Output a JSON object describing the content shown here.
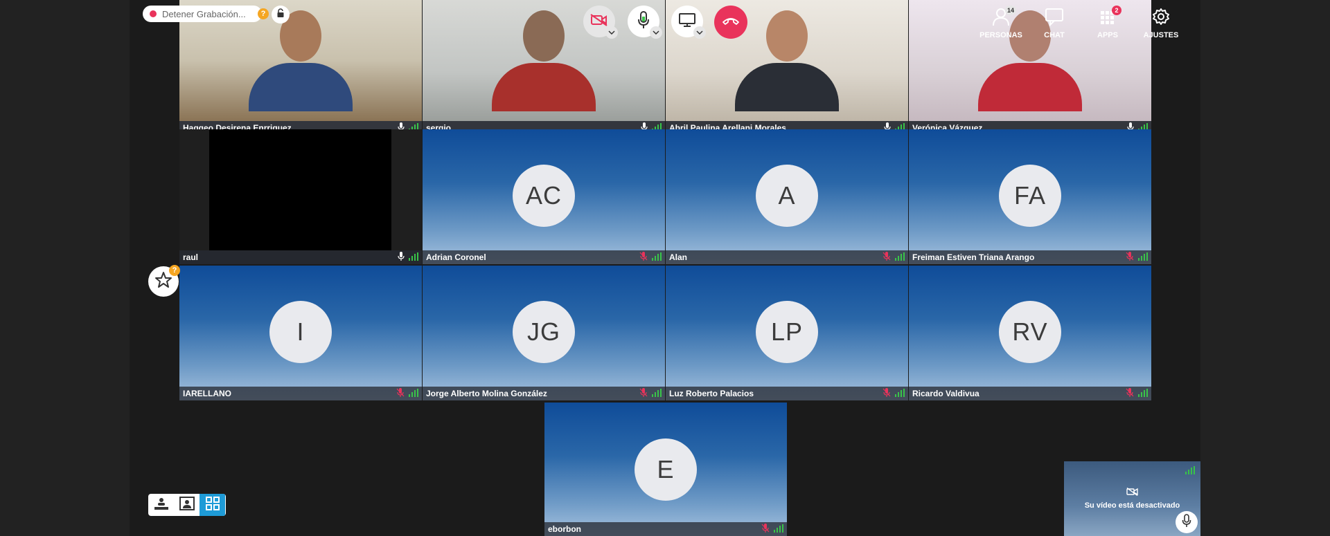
{
  "recording": {
    "label": "Detener Grabación...",
    "help_badge": "?"
  },
  "toolbar": {
    "personas": {
      "label": "PERSONAS",
      "count": "14"
    },
    "chat": {
      "label": "CHAT"
    },
    "apps": {
      "label": "APPS",
      "count": "2"
    },
    "ajustes": {
      "label": "AJUSTES"
    }
  },
  "favorites_badge": "?",
  "participants": [
    {
      "name": "Haggeo Desirena Enrriquez",
      "kind": "video",
      "muted": false
    },
    {
      "name": "sergio",
      "kind": "video",
      "muted": false
    },
    {
      "name": "Abril Paulina Arellani Morales",
      "kind": "video",
      "muted": false
    },
    {
      "name": "Verónica Vázquez",
      "kind": "video",
      "muted": false
    },
    {
      "name": "raul",
      "kind": "blank",
      "muted": false
    },
    {
      "name": "Adrian Coronel",
      "initials": "AC",
      "kind": "avatar",
      "muted": true
    },
    {
      "name": "Alan",
      "initials": "A",
      "kind": "avatar",
      "muted": true
    },
    {
      "name": "Freiman Estiven Triana Arango",
      "initials": "FA",
      "kind": "avatar",
      "muted": true
    },
    {
      "name": "IARELLANO",
      "initials": "I",
      "kind": "avatar",
      "muted": true
    },
    {
      "name": "Jorge Alberto Molina González",
      "initials": "JG",
      "kind": "avatar",
      "muted": true
    },
    {
      "name": "Luz Roberto Palacios",
      "initials": "LP",
      "kind": "avatar",
      "muted": true
    },
    {
      "name": "Ricardo Valdivua",
      "initials": "RV",
      "kind": "avatar",
      "muted": true
    },
    {
      "name": "eborbon",
      "initials": "E",
      "kind": "avatar",
      "muted": true
    }
  ],
  "self_view": {
    "message": "Su vídeo está desactivado"
  },
  "colors": {
    "accent": "#1e9bd7",
    "hangup": "#e9335b",
    "muted_mic": "#e9335b",
    "signal": "#39c449"
  },
  "icons": [
    "camera-off-icon",
    "microphone-icon",
    "screen-share-icon",
    "hangup-icon",
    "people-icon",
    "chat-icon",
    "apps-icon",
    "gear-icon",
    "lock-icon",
    "star-icon",
    "signal-icon"
  ]
}
